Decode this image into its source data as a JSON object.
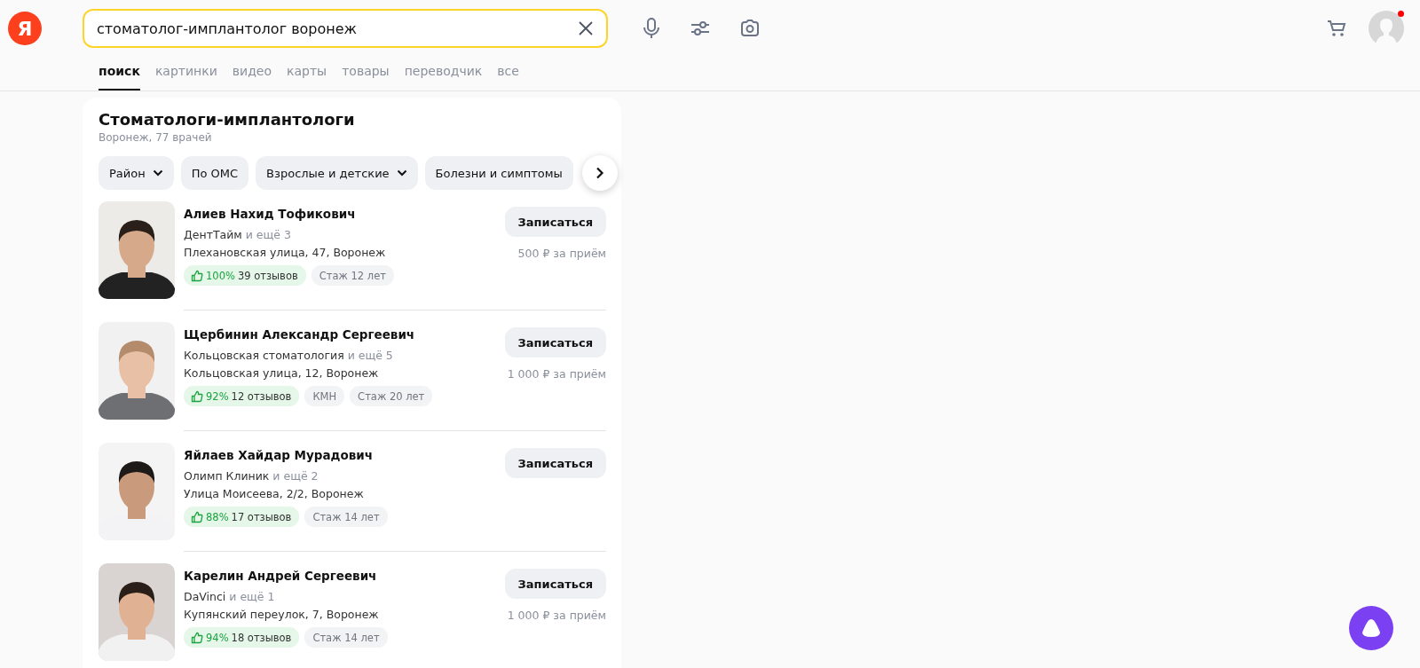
{
  "header": {
    "logo": "Я",
    "search": {
      "value": "стоматолог-имплантолог воронеж"
    },
    "avatar": {
      "notification": true
    }
  },
  "tabs": [
    {
      "label": "поиск",
      "selected": true
    },
    {
      "label": "картинки",
      "selected": false
    },
    {
      "label": "видео",
      "selected": false
    },
    {
      "label": "карты",
      "selected": false
    },
    {
      "label": "товары",
      "selected": false
    },
    {
      "label": "переводчик",
      "selected": false
    },
    {
      "label": "все",
      "selected": false
    }
  ],
  "card": {
    "title": "Стоматологи-имплантологи",
    "subtitle": "Воронеж, 77 врачей",
    "filters": [
      {
        "label": "Район",
        "dropdown": true
      },
      {
        "label": "По ОМС",
        "dropdown": false
      },
      {
        "label": "Взрослые и детские",
        "dropdown": true
      },
      {
        "label": "Болезни и симптомы",
        "dropdown": false
      }
    ],
    "doctors": [
      {
        "kind": "picture",
        "name": "Алиев Нахид Тофикович",
        "clinic": "ДентТайм",
        "more": "и ещё 3",
        "address": "Плехановская улица, 47, Воронеж",
        "rating": "100%",
        "reviews": "39 отзывов",
        "tags": [
          "Стаж 12 лет"
        ],
        "button": "Записаться",
        "price": "500 ₽ за приём"
      },
      {
        "kind": "picture",
        "name": "Щербинин Александр Сергеевич",
        "clinic": "Кольцовская стоматология",
        "more": "и ещё 5",
        "address": "Кольцовская улица, 12, Воронеж",
        "rating": "92%",
        "reviews": "12 отзывов",
        "tags": [
          "КМН",
          "Стаж 20 лет"
        ],
        "button": "Записаться",
        "price": "1 000 ₽ за приём"
      },
      {
        "kind": "picture",
        "name": "Яйлаев Хайдар Мурадович",
        "clinic": "Олимп Клиник",
        "more": "и ещё 2",
        "address": "Улица Моисеева, 2/2, Воронеж",
        "rating": "88%",
        "reviews": "17 отзывов",
        "tags": [
          "Стаж 14 лет"
        ],
        "button": "Записаться"
      },
      {
        "kind": "picture",
        "name": "Карелин Андрей Сергеевич",
        "clinic": "DaVinci",
        "more": "и ещё 1",
        "address": "Купянский переулок, 7, Воронеж",
        "rating": "94%",
        "reviews": "18 отзывов",
        "tags": [
          "Стаж 14 лет"
        ],
        "button": "Записаться",
        "price": "1 000 ₽ за приём"
      }
    ]
  }
}
